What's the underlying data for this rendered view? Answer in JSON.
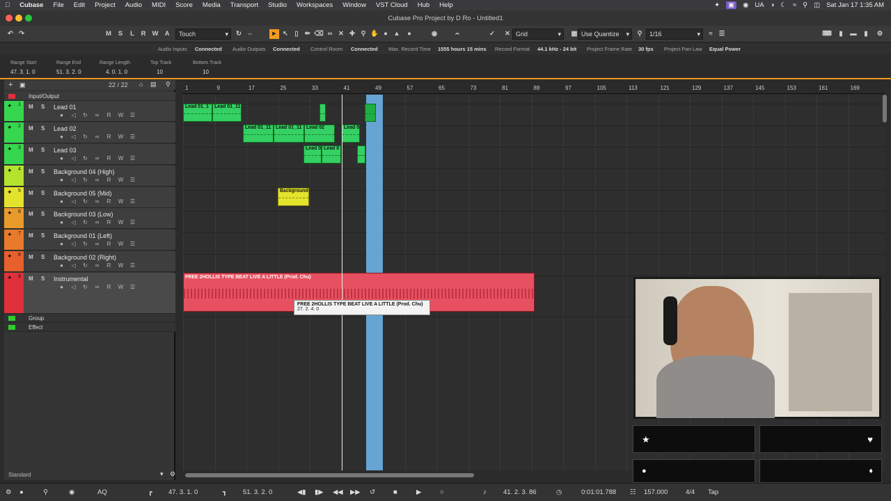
{
  "menubar": {
    "app": "Cubase",
    "items": [
      "File",
      "Edit",
      "Project",
      "Audio",
      "MIDI",
      "Score",
      "Media",
      "Transport",
      "Studio",
      "Workspaces",
      "Window",
      "VST Cloud",
      "Hub",
      "Help"
    ],
    "lang": "UA",
    "clock": "Sat Jan 17  1:35 AM"
  },
  "window": {
    "title": "Cubase Pro Project by D Ro - Untitled1"
  },
  "toolbar": {
    "btns": [
      "M",
      "S",
      "L",
      "R",
      "W",
      "A"
    ],
    "automation_mode": "Touch",
    "snap_type": "Grid",
    "quantize_mode": "Use Quantize",
    "quantize_value": "1/16"
  },
  "status": {
    "audio_inputs_label": "Audio Inputs",
    "audio_inputs": "Connected",
    "audio_outputs_label": "Audio Outputs",
    "audio_outputs": "Connected",
    "control_room_label": "Control Room",
    "control_room": "Connected",
    "max_rec_label": "Max. Record Time",
    "max_rec": "1555 hours 15 mins",
    "rec_format_label": "Record Format",
    "rec_format": "44.1 kHz - 24 bit",
    "frame_rate_label": "Project Frame Rate",
    "frame_rate": "30 fps",
    "pan_law_label": "Project Pan Law",
    "pan_law": "Equal Power"
  },
  "info": {
    "range_start_label": "Range Start",
    "range_start": "47. 3. 1.   0",
    "range_end_label": "Range End",
    "range_end": "51. 3. 2.   0",
    "range_length_label": "Range Length",
    "range_length": "4. 0. 1.   0",
    "top_track_label": "Top Track",
    "top_track": "10",
    "bottom_track_label": "Bottom Track",
    "bottom_track": "10"
  },
  "tracklist": {
    "count": "22 / 22",
    "io_label": "Input/Output",
    "tracks": [
      {
        "num": "1",
        "name": "Lead 01",
        "color": "#37d64f"
      },
      {
        "num": "2",
        "name": "Lead 02",
        "color": "#37d64f"
      },
      {
        "num": "3",
        "name": "Lead 03",
        "color": "#37d64f"
      },
      {
        "num": "4",
        "name": "Background 04 (High)",
        "color": "#b4e22d"
      },
      {
        "num": "5",
        "name": "Background 05 (Mid)",
        "color": "#e3e32d"
      },
      {
        "num": "6",
        "name": "Background 03 (Low)",
        "color": "#e89a2b"
      },
      {
        "num": "7",
        "name": "Background 01 (Left)",
        "color": "#e87a2b"
      },
      {
        "num": "8",
        "name": "Background 02 (Right)",
        "color": "#e8602b"
      },
      {
        "num": "9",
        "name": "Instrumental",
        "color": "#e0303c"
      }
    ],
    "group_label": "Group",
    "effect_label": "Effect",
    "footer": "Standard"
  },
  "ruler": [
    "1",
    "9",
    "17",
    "25",
    "33",
    "41",
    "49",
    "57",
    "65",
    "73",
    "81",
    "89",
    "97",
    "105",
    "113",
    "121",
    "129",
    "137",
    "145",
    "153",
    "161",
    "169"
  ],
  "events": {
    "lead01_a": "Lead 01_1",
    "lead01_b": "Lead 01_11",
    "lead02_a": "Lead 01_11",
    "lead02_b": "Lead 01_11",
    "lead02_c": "Lead 02",
    "lead02_d": "Lead 0",
    "lead03_a": "Lead 0",
    "lead03_b": "Lead 0",
    "bg05": "Background",
    "instrumental": "FREE 2HOLLIS TYPE BEAT  LIVE A LITTLE (Prod. Chu)"
  },
  "tooltip": {
    "title": "FREE 2HOLLIS TYPE BEAT  LIVE A LITTLE (Prod. Chu)",
    "pos": "27. 2. 4.   0"
  },
  "transport": {
    "left_locator": "47. 3. 1.   0",
    "right_locator": "51. 3. 2.   0",
    "position": "41. 2. 3.  86",
    "time": "0:01:01.788",
    "tempo": "157.000",
    "signature": "4/4",
    "tap": "Tap",
    "aq": "AQ"
  }
}
